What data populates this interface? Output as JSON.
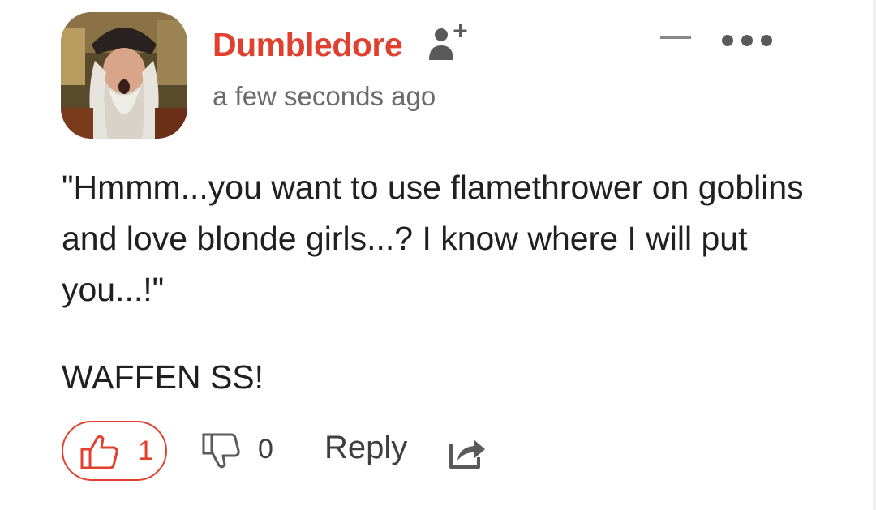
{
  "comment": {
    "username": "Dumbledore",
    "timestamp": "a few seconds ago",
    "body": [
      "\"Hmmm...you want to use flamethrower on goblins and love blonde girls...? I know where I will put you...!\"",
      "WAFFEN SS!"
    ],
    "likes": "1",
    "dislikes": "0",
    "reply_label": "Reply"
  },
  "icons": {
    "follow": "add-user-icon",
    "collapse": "minus-icon",
    "more": "ellipsis-icon",
    "like": "thumbs-up-icon",
    "dislike": "thumbs-down-icon",
    "share": "share-icon"
  },
  "colors": {
    "accent": "#e0402d",
    "text": "#202020",
    "muted": "#6b6b6b",
    "icon": "#5a5a5a"
  }
}
